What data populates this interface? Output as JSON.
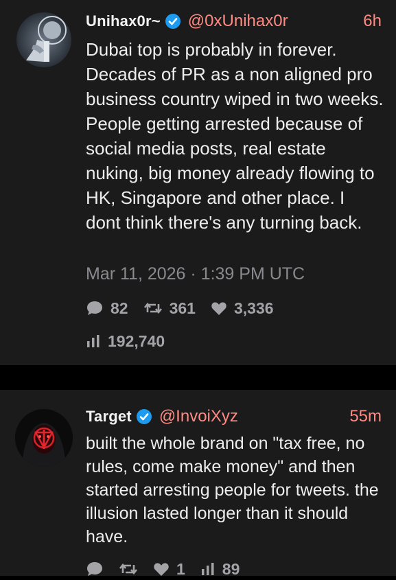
{
  "posts": [
    {
      "display_name": "Unihax0r~",
      "verified_icon": "verified-badge-icon",
      "handle": "@0xUnihax0r",
      "time": "6h",
      "text": "Dubai top is probably in forever. Decades of PR as a non aligned pro business country wiped in two weeks. People getting arrested because of social media posts, real estate nuking, big money already flowing to HK, Singapore and other place. I dont think there's any turning back.",
      "timestamp": "Mar 11, 2026 · 1:39 PM UTC",
      "replies": "82",
      "reposts": "361",
      "likes": "3,336",
      "views": "192,740"
    },
    {
      "display_name": "Target",
      "verified_icon": "verified-badge-icon",
      "handle": "@InvoiXyz",
      "time": "55m",
      "text": "built the whole brand on \"tax free, no rules, come make money\" and then started arresting people for tweets. the illusion lasted longer than it should have.",
      "replies": "",
      "reposts": "",
      "likes": "1",
      "views": "89"
    }
  ],
  "colors": {
    "background": "#000000",
    "card": "#1b1b1c",
    "accent": "#ff8a82",
    "verified": "#1d9bf0",
    "muted": "#8a8a8e"
  }
}
